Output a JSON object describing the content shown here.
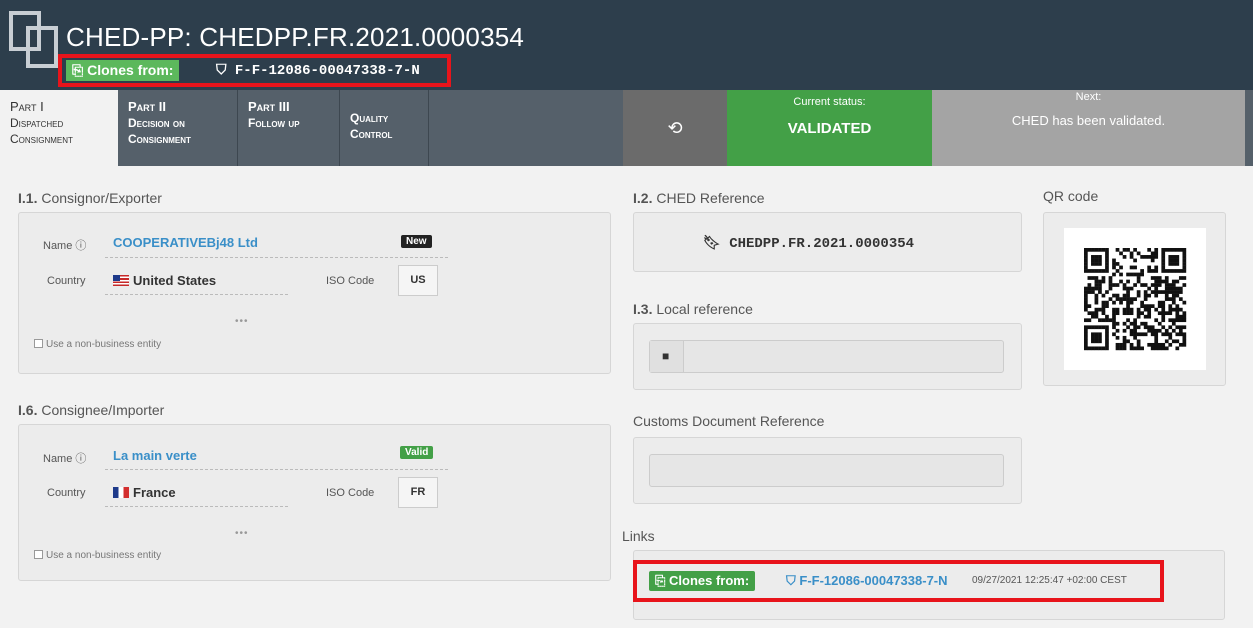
{
  "header": {
    "title": "CHED-PP: CHEDPP.FR.2021.0000354",
    "clones_label": "Clones from:",
    "clones_ref": "F-F-12086-00047338-7-N"
  },
  "tabs": [
    {
      "line1": "Part I",
      "line2": "Dispatched",
      "line3": "Consignment"
    },
    {
      "line1": "Part II",
      "line2": "Decision on",
      "line3": "Consignment"
    },
    {
      "line1": "Part III",
      "line2": "Follow up",
      "line3": ""
    },
    {
      "line1": "",
      "line2": "Quality",
      "line3": "Control"
    }
  ],
  "status": {
    "current_label": "Current status:",
    "current_value": "VALIDATED",
    "next_label": "Next:",
    "next_value": "CHED has been validated."
  },
  "consignor": {
    "section_num": "I.1.",
    "section_title": "Consignor/Exporter",
    "name_label": "Name",
    "name_value": "COOPERATIVEBj48 Ltd",
    "name_tag": "New",
    "country_label": "Country",
    "country_value": "United States",
    "iso_label": "ISO Code",
    "iso_value": "US",
    "dots": "•••",
    "checkbox_label": "Use a non-business entity"
  },
  "consignee": {
    "section_num": "I.6.",
    "section_title": "Consignee/Importer",
    "name_label": "Name",
    "name_value": "La main verte",
    "name_tag": "Valid",
    "country_label": "Country",
    "country_value": "France",
    "iso_label": "ISO Code",
    "iso_value": "FR",
    "dots": "•••",
    "checkbox_label": "Use a non-business entity"
  },
  "ched_ref": {
    "section_num": "I.2.",
    "section_title": "CHED Reference",
    "value": "CHEDPP.FR.2021.0000354"
  },
  "local_ref": {
    "section_num": "I.3.",
    "section_title": "Local reference",
    "value": ""
  },
  "customs": {
    "section_title": "Customs Document Reference",
    "value": ""
  },
  "qr": {
    "section_title": "QR code"
  },
  "links": {
    "section_title": "Links",
    "clones_label": "Clones from:",
    "ref": "F-F-12086-00047338-7-N",
    "timestamp": "09/27/2021 12:25:47 +02:00 CEST"
  },
  "colors": {
    "header_bg": "#2d3e4c",
    "tab_bg": "#55606a",
    "status_green": "#43a047",
    "next_grey": "#a4a4a4",
    "highlight_red": "#e8141b",
    "link_blue": "#3a8fc8"
  }
}
